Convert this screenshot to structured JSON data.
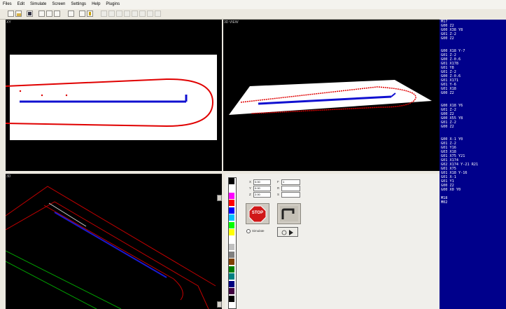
{
  "menu": [
    "Files",
    "Edit",
    "Simulate",
    "Screen",
    "Settings",
    "Help",
    "Plugins"
  ],
  "toolbar_icons": [
    "new-icon",
    "open-icon",
    "save-icon",
    "cut-icon",
    "copy-icon",
    "paste-icon",
    "undo-icon",
    "print-icon",
    "help-icon",
    "view-1-icon",
    "view-2-icon",
    "view-3-icon",
    "view-4-icon",
    "view-5-icon",
    "view-6-icon",
    "view-7-icon",
    "view-8-icon"
  ],
  "panes": {
    "top_left_title": "XY",
    "top_right_title": "3D VIEW",
    "bottom_left_title": "3D"
  },
  "gcode": [
    "M17",
    "G00 Z2",
    "G00 X38 Y8",
    "G01 Z-2",
    "G00 Z2",
    "",
    "",
    "G00 X18 Y-7",
    "G01 Z-2",
    "G00 Z-0.6",
    "G01 X178",
    "G01 Y8",
    "G01 Z-2",
    "G00 Z-0.6",
    "G01 X171",
    "G01 Y-6",
    "G01 X18",
    "G00 Z2",
    "",
    "",
    "G00 X18 Y6",
    "G01 Z-2",
    "G00 Z2",
    "G00 X55 Y8",
    "G01 Z-2",
    "G00 Z2",
    "",
    "",
    "G00 X-1 Y0",
    "G01 Z-2",
    "G01 Y16",
    "G03 X18",
    "G01 X75 Y21",
    "G01 X174",
    "G02 X174 Y-21 R21",
    "G01 X75",
    "G01 X18 Y-16",
    "G01 X-1",
    "G01 Y1",
    "G00 Z2",
    "G00 X0 Y0",
    "",
    "M18",
    "M02"
  ],
  "palette": [
    "#000000",
    "#ffffff",
    "#ff00ff",
    "#ff0000",
    "#0000ff",
    "#00c0ff",
    "#00ff00",
    "#ffff00",
    "#ffffff",
    "#c0c0c0",
    "#808080",
    "#804000",
    "#008000",
    "#008080",
    "#000080",
    "#400040",
    "#000000",
    "#ffffff"
  ],
  "controls": {
    "x_label": "X",
    "x_value": "0.00",
    "y_label": "Y",
    "y_value": "0.00",
    "z_label": "Z",
    "z_value": "2.00",
    "f_label": "F",
    "f_value": "1",
    "r_label": "R",
    "r_value": "",
    "s_label": "S",
    "s_value": "",
    "stop_label": "STOP",
    "radio_label": "Simulate"
  }
}
